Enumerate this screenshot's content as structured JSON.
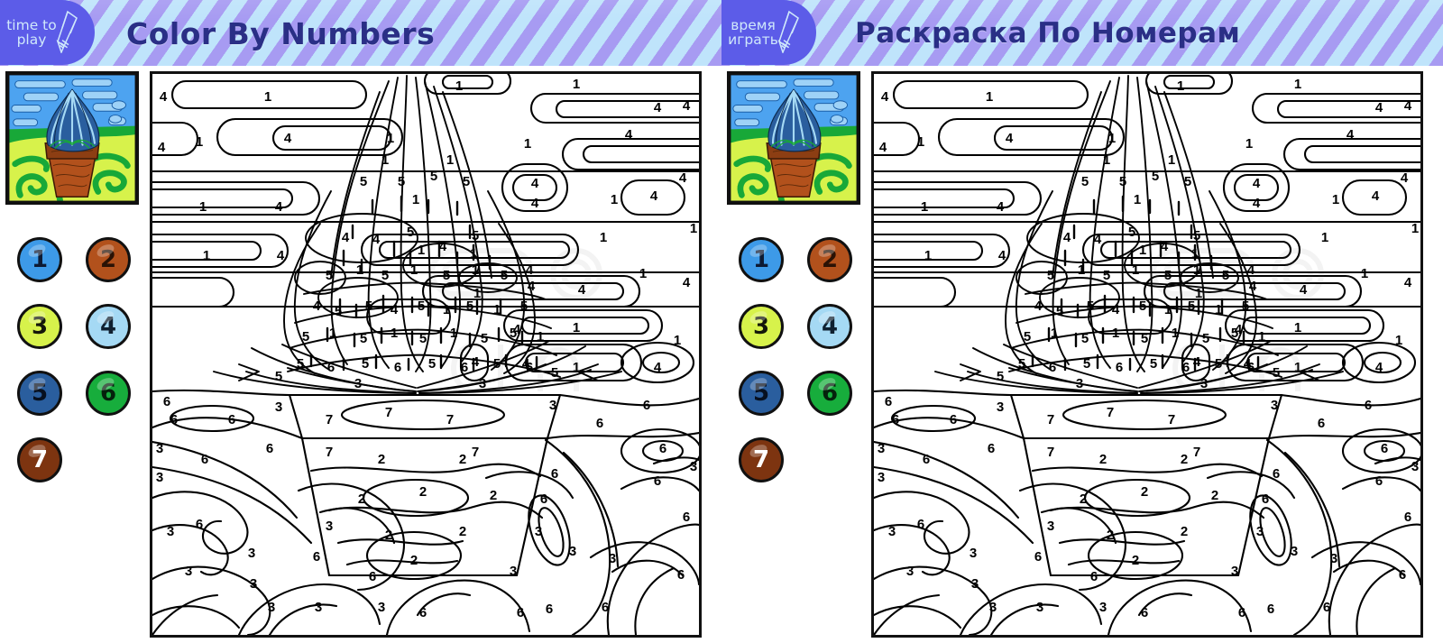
{
  "panels": [
    {
      "id": "english",
      "badge": {
        "line1": "time to",
        "line2": "play",
        "icon": "pencil-icon"
      },
      "title": "Color By Numbers"
    },
    {
      "id": "russian",
      "badge": {
        "line1": "время",
        "line2": "играть",
        "icon": "pencil-icon"
      },
      "title": "Раскраска По Номерам"
    }
  ],
  "legend": {
    "title": "color-key",
    "items": [
      {
        "number": "1",
        "color": "#3d9ae8",
        "text_color": "#0d1a33",
        "name": "blue"
      },
      {
        "number": "2",
        "color": "#b2511c",
        "text_color": "#2a1205",
        "name": "dark-orange-brown"
      },
      {
        "number": "3",
        "color": "#d7f24b",
        "text_color": "#14170a",
        "name": "yellow-green"
      },
      {
        "number": "4",
        "color": "#a5d9f4",
        "text_color": "#102030",
        "name": "light-blue"
      },
      {
        "number": "5",
        "color": "#2a5e9e",
        "text_color": "#07101f",
        "name": "dark-blue"
      },
      {
        "number": "6",
        "color": "#17ad3c",
        "text_color": "#05210c",
        "name": "green"
      },
      {
        "number": "7",
        "color": "#7d3410",
        "text_color": "#ffffff",
        "name": "dark-brown"
      }
    ]
  },
  "thumbnail": {
    "name": "reference-picture",
    "subject": "blue plant in a brown flower pot on green grass with blue sky",
    "colors": {
      "sky": "#4da3f0",
      "sky_light": "#9ed2f7",
      "grass_green": "#18a838",
      "grass_yellow": "#d7f24b",
      "pot": "#b2511c",
      "pot_dark": "#7d3410",
      "plant": "#2a5e9e",
      "plant_light": "#a5d9f4"
    }
  },
  "canvas": {
    "name": "color-by-numbers-line-art",
    "regions_legend": "numbered outline regions to be colored",
    "numbers_used": [
      "1",
      "2",
      "3",
      "4",
      "5",
      "6",
      "7"
    ]
  },
  "chart_data": {
    "type": "table",
    "title": "Color By Numbers key",
    "categories": [
      "1",
      "2",
      "3",
      "4",
      "5",
      "6",
      "7"
    ],
    "values": [
      "#3d9ae8",
      "#b2511c",
      "#d7f24b",
      "#a5d9f4",
      "#2a5e9e",
      "#17ad3c",
      "#7d3410"
    ]
  },
  "sky_numbers": [
    "1",
    "4"
  ],
  "plant_numbers": [
    "1",
    "4",
    "5"
  ],
  "pot_numbers": [
    "2",
    "7"
  ],
  "grass_numbers": [
    "3",
    "6"
  ]
}
